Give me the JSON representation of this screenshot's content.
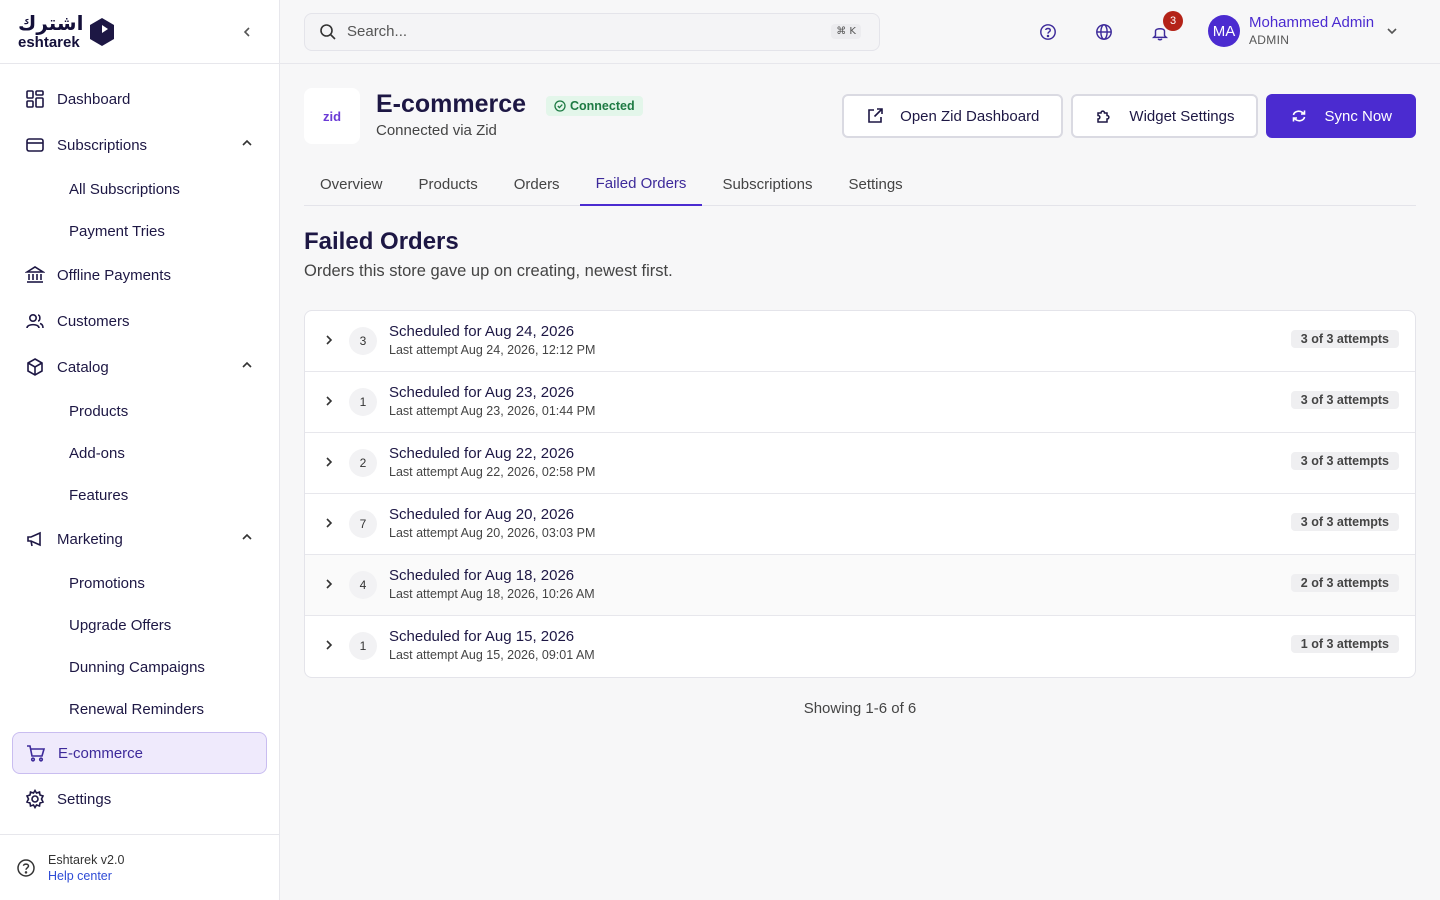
{
  "brand": {
    "ar": "اشترك",
    "en": "eshtarek"
  },
  "sidebar": {
    "items": [
      {
        "label": "Dashboard",
        "icon": "dashboard-icon"
      },
      {
        "label": "Subscriptions",
        "icon": "card-icon",
        "expanded": true,
        "children": [
          "All Subscriptions",
          "Payment Tries"
        ]
      },
      {
        "label": "Offline Payments",
        "icon": "bank-icon"
      },
      {
        "label": "Customers",
        "icon": "users-icon"
      },
      {
        "label": "Catalog",
        "icon": "box-icon",
        "expanded": true,
        "children": [
          "Products",
          "Add-ons",
          "Features"
        ]
      },
      {
        "label": "Marketing",
        "icon": "megaphone-icon",
        "expanded": true,
        "children": [
          "Promotions",
          "Upgrade Offers",
          "Dunning Campaigns",
          "Renewal Reminders"
        ]
      },
      {
        "label": "E-commerce",
        "icon": "cart-icon",
        "active": true
      },
      {
        "label": "Settings",
        "icon": "gear-icon"
      }
    ],
    "footer": {
      "version": "Eshtarek v2.0",
      "help": "Help center"
    }
  },
  "topbar": {
    "search_placeholder": "Search...",
    "shortcut": "⌘ K",
    "notifications_count": "3",
    "user": {
      "initials": "MA",
      "name": "Mohammed Admin",
      "role": "ADMIN"
    }
  },
  "store": {
    "logo_text": "zid",
    "title": "E-commerce",
    "status": "Connected",
    "subtitle": "Connected via Zid",
    "actions": {
      "open_dashboard": "Open Zid Dashboard",
      "widget_settings": "Widget Settings",
      "sync": "Sync Now"
    }
  },
  "tabs": [
    "Overview",
    "Products",
    "Orders",
    "Failed Orders",
    "Subscriptions",
    "Settings"
  ],
  "active_tab": "Failed Orders",
  "section": {
    "title": "Failed Orders",
    "subtitle": "Orders this store gave up on creating, newest first."
  },
  "orders": [
    {
      "count": "3",
      "title": "Scheduled for Aug 24, 2026",
      "meta": "Last attempt Aug 24, 2026, 12:12 PM",
      "attempts": "3 of 3 attempts"
    },
    {
      "count": "1",
      "title": "Scheduled for Aug 23, 2026",
      "meta": "Last attempt Aug 23, 2026, 01:44 PM",
      "attempts": "3 of 3 attempts"
    },
    {
      "count": "2",
      "title": "Scheduled for Aug 22, 2026",
      "meta": "Last attempt Aug 22, 2026, 02:58 PM",
      "attempts": "3 of 3 attempts"
    },
    {
      "count": "7",
      "title": "Scheduled for Aug 20, 2026",
      "meta": "Last attempt Aug 20, 2026, 03:03 PM",
      "attempts": "3 of 3 attempts"
    },
    {
      "count": "4",
      "title": "Scheduled for Aug 18, 2026",
      "meta": "Last attempt Aug 18, 2026, 10:26 AM",
      "attempts": "2 of 3 attempts"
    },
    {
      "count": "1",
      "title": "Scheduled for Aug 15, 2026",
      "meta": "Last attempt Aug 15, 2026, 09:01 AM",
      "attempts": "1 of 3 attempts"
    }
  ],
  "pagination": "Showing 1-6 of 6",
  "colors": {
    "accent": "#4b2bd0",
    "success_bg": "#e3f6ea",
    "success_text": "#1d7a43",
    "badge": "#b42318"
  }
}
